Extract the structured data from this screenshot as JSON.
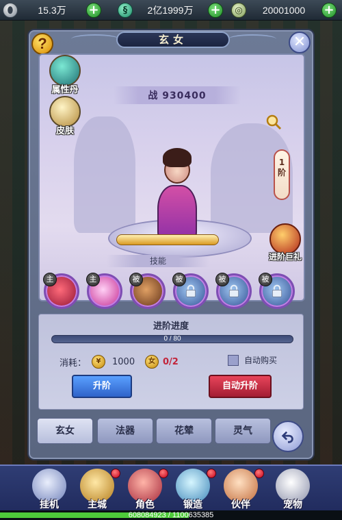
{
  "topbar": {
    "resources": [
      {
        "icon": "silver-ingot-icon",
        "value": "15.3万"
      },
      {
        "icon": "jade-dragon-icon",
        "value": "2亿1999万"
      },
      {
        "icon": "coin-stack-icon",
        "value": "20001000"
      }
    ]
  },
  "panel": {
    "title": "玄女",
    "help_label": "?",
    "power_label": "战 930400",
    "stage_badge": "1\n阶",
    "side_buttons": [
      {
        "label": "属性丹",
        "icon": "attribute-pill-icon"
      },
      {
        "label": "皮肤",
        "icon": "skin-helmet-icon"
      },
      {
        "label": "进阶巨礼",
        "icon": "advance-gift-chest-icon"
      }
    ],
    "skills_label": "技能",
    "skills": [
      {
        "tag": "主",
        "locked": false
      },
      {
        "tag": "主",
        "locked": false
      },
      {
        "tag": "被",
        "locked": false
      },
      {
        "tag": "被",
        "locked": true
      },
      {
        "tag": "被",
        "locked": true
      },
      {
        "tag": "被",
        "locked": true
      }
    ],
    "progress": {
      "title": "进阶进度",
      "text": "0 / 80",
      "current": 0,
      "max": 80
    },
    "cost": {
      "label": "消耗：",
      "coin_amount": "1000",
      "item_icon_text": "女",
      "item_count": "0/2"
    },
    "auto_buy_label": "自动购买",
    "upgrade_button": "升阶",
    "auto_upgrade_button": "自动升阶",
    "tabs": [
      "玄女",
      "法器",
      "花辇",
      "灵气"
    ],
    "active_tab": 0
  },
  "bottom_nav": {
    "items": [
      {
        "label": "挂机",
        "icon": "sword-icon",
        "badge": false
      },
      {
        "label": "主城",
        "icon": "city-gate-icon",
        "badge": true
      },
      {
        "label": "角色",
        "icon": "character-portrait-icon",
        "badge": true
      },
      {
        "label": "锻造",
        "icon": "hammer-icon",
        "badge": true
      },
      {
        "label": "伙伴",
        "icon": "partners-icon",
        "badge": true
      },
      {
        "label": "宠物",
        "icon": "panda-pet-icon",
        "badge": false
      }
    ]
  },
  "exp": {
    "text": "608084923 / 1100635385",
    "fraction": 0.5525
  },
  "colors": {
    "panel": "#6d7a96",
    "stage": "#d7d0ec",
    "upgrade_button": "#2f63c9",
    "auto_upgrade_button": "#a31d33",
    "exp_fill": "#4ecb3a"
  }
}
